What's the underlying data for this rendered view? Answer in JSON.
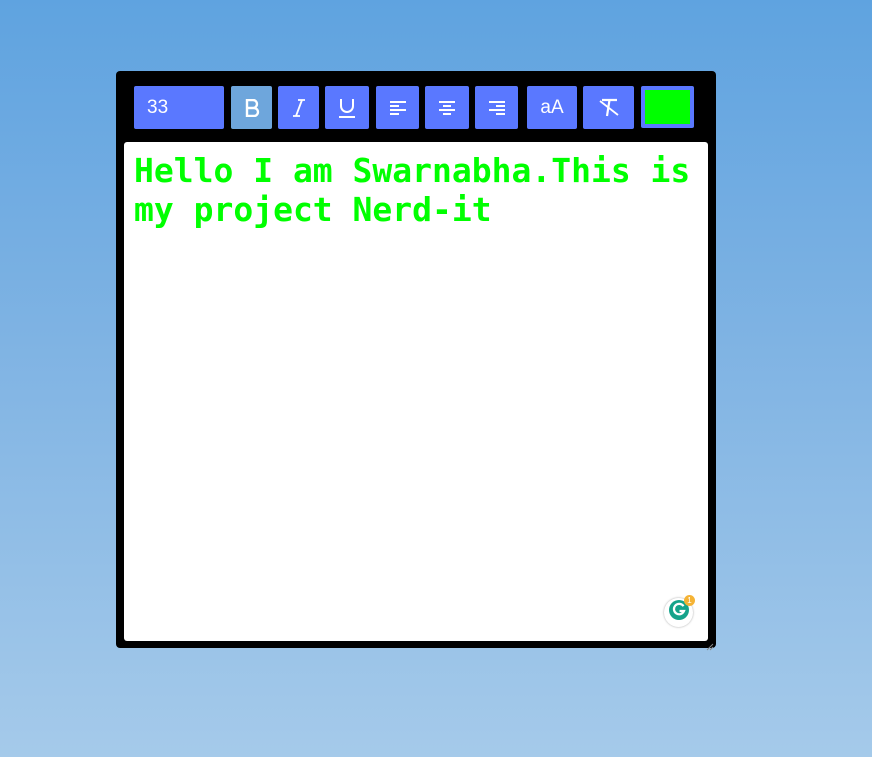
{
  "toolbar": {
    "font_size": "33",
    "case_label": "aA",
    "bold_active": true,
    "text_color": "#00ff00",
    "icons": {
      "bold": "bold-icon",
      "italic": "italic-icon",
      "underline": "underline-icon",
      "align_left": "align-left-icon",
      "align_center": "align-center-icon",
      "align_right": "align-right-icon",
      "clear_format": "clear-format-icon"
    }
  },
  "editor": {
    "text": "Hello I am Swarnabha.This is my project Nerd-it"
  },
  "grammarly": {
    "badge_count": "1"
  },
  "colors": {
    "button_bg": "#5a78ff",
    "button_active_bg": "#6ea6dc",
    "editor_bg": "#000000",
    "text_color": "#00ff00"
  }
}
